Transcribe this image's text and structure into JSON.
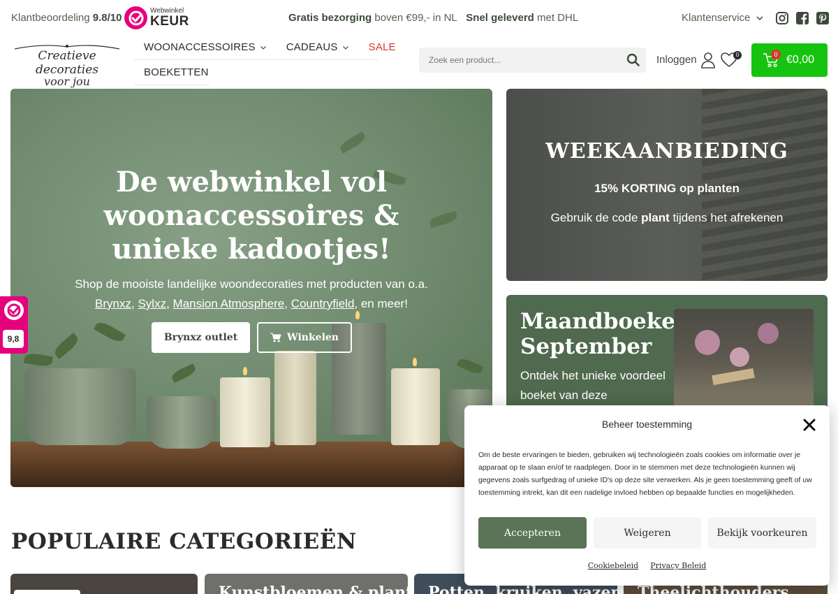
{
  "topbar": {
    "rating_label": "Klantbeoordeling",
    "rating_value": "9.8/10",
    "keur_small": "Webwinkel",
    "keur_big": "KEUR",
    "promo_bold1": "Gratis bezorging",
    "promo_text1": " boven €99,- in NL",
    "promo_bold2": "Snel geleverd",
    "promo_text2": " met DHL",
    "service_label": "Klantenservice",
    "socials": [
      "instagram-icon",
      "facebook-icon",
      "pinterest-icon"
    ]
  },
  "header": {
    "logo_line1": "Creatieve decoraties",
    "logo_line2": "voor jou",
    "nav": [
      {
        "label": "WOONACCESSOIRES",
        "dropdown": true
      },
      {
        "label": "CADEAUS",
        "dropdown": true
      },
      {
        "label": "SALE",
        "dropdown": false
      }
    ],
    "nav_row2": {
      "label": "BOEKETTEN"
    },
    "search_placeholder": "Zoek een product...",
    "login_label": "Inloggen",
    "wishlist_count": "0",
    "cart_count": "0",
    "cart_total": "€0,00",
    "colors": {
      "cart": "#16c40f",
      "sale": "#d9352b"
    }
  },
  "hero": {
    "title": "De webwinkel vol woonaccessoires & unieke kadootjes!",
    "sub_intro": "Shop de mooiste landelijke woondecoraties met producten van o.a.",
    "brands": [
      "Brynxz",
      "Sylxz",
      "Mansion Atmosphere",
      "Countryfield"
    ],
    "sub_outro": ", en meer!",
    "btn_outlet": "Brynxz outlet",
    "btn_shop": "Winkelen"
  },
  "weekaanbieding": {
    "title": "WEEKAANBIEDING",
    "subtitle": "15% KORTING op planten",
    "code_pre": "Gebruik de code ",
    "code": "plant",
    "code_post": " tijdens het afrekenen"
  },
  "maandboeket": {
    "title": "Maandboeket September",
    "text": "Ontdek het unieke voordeel boeket van deze"
  },
  "side_badge": {
    "score": "9,8"
  },
  "categories": {
    "title": "POPULAIRE CATEGORIEËN",
    "cards": [
      "",
      "Kunstbloemen & planten",
      "Potten, kruiken, vazen &",
      "Theelichthouders"
    ]
  },
  "consent": {
    "title": "Beheer toestemming",
    "body": "Om de beste ervaringen te bieden, gebruiken wij technologieën zoals cookies om informatie over je apparaat op te slaan en/of te raadplegen. Door in te stemmen met deze technologieën kunnen wij gegevens zoals surfgedrag of unieke ID's op deze site verwerken. Als je geen toestemming geeft of uw toestemming intrekt, kan dit een nadelige invloed hebben op bepaalde functies en mogelijkheden.",
    "accept": "Accepteren",
    "deny": "Weigeren",
    "prefs": "Bekijk voorkeuren",
    "link_cookie": "Cookiebeleid",
    "link_privacy": "Privacy Beleid"
  }
}
